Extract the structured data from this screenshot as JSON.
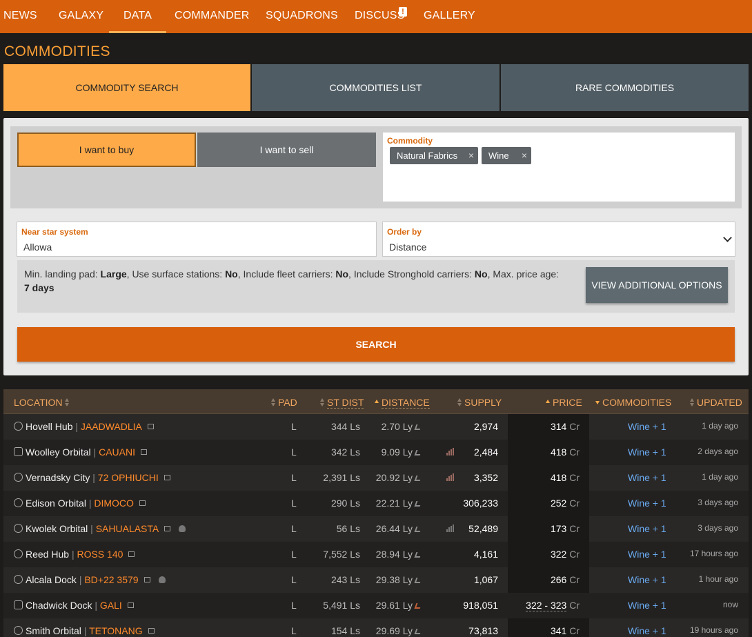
{
  "nav": {
    "items": [
      "NEWS",
      "GALAXY",
      "DATA",
      "COMMANDER",
      "SQUADRONS",
      "DISCUSS",
      "GALLERY"
    ],
    "discuss_badge": "!"
  },
  "page_title": "COMMODITIES",
  "tabs": [
    "COMMODITY SEARCH",
    "COMMODITIES LIST",
    "RARE COMMODITIES"
  ],
  "search": {
    "buy_label": "I want to buy",
    "sell_label": "I want to sell",
    "commodity_label": "Commodity",
    "commodities": [
      "Natural Fabrics",
      "Wine"
    ],
    "remove_glyph": "×",
    "near_label": "Near star system",
    "near_value": "Allowa",
    "order_label": "Order by",
    "order_value": "Distance",
    "options": {
      "pad_label": "Min. landing pad:",
      "pad_value": "Large",
      "surface_label": "Use surface stations:",
      "surface_value": "No",
      "fleet_label": "Include fleet carriers:",
      "fleet_value": "No",
      "stronghold_label": "Include Stronghold carriers:",
      "stronghold_value": "No",
      "age_label": "Max. price age:",
      "age_value": "7 days"
    },
    "view_options_label": "VIEW ADDITIONAL OPTIONS",
    "search_label": "SEARCH"
  },
  "table": {
    "headers": {
      "location": "LOCATION",
      "pad": "PAD",
      "st_dist": "ST DIST",
      "distance": "DISTANCE",
      "supply": "SUPPLY",
      "price": "PRICE",
      "commodities": "COMMODITIES",
      "updated": "UPDATED"
    },
    "rows": [
      {
        "station": "Hovell Hub",
        "system": "JAADWADLIA",
        "pad": "L",
        "st_dist": "344 Ls",
        "distance": "2.70 Ly",
        "supply": "2,974",
        "price": "314",
        "commodities": "Wine + 1",
        "updated": "1 day ago"
      },
      {
        "station": "Woolley Orbital",
        "system": "CAUANI",
        "pad": "L",
        "st_dist": "342 Ls",
        "distance": "9.09 Ly",
        "supply": "2,484",
        "price": "418",
        "commodities": "Wine + 1",
        "updated": "2 days ago"
      },
      {
        "station": "Vernadsky City",
        "system": "72 OPHIUCHI",
        "pad": "L",
        "st_dist": "2,391 Ls",
        "distance": "20.92 Ly",
        "supply": "3,352",
        "price": "418",
        "commodities": "Wine + 1",
        "updated": "1 day ago"
      },
      {
        "station": "Edison Orbital",
        "system": "DIMOCO",
        "pad": "L",
        "st_dist": "290 Ls",
        "distance": "22.21 Ly",
        "supply": "306,233",
        "price": "252",
        "commodities": "Wine + 1",
        "updated": "3 days ago"
      },
      {
        "station": "Kwolek Orbital",
        "system": "SAHUALASTA",
        "pad": "L",
        "st_dist": "56 Ls",
        "distance": "26.44 Ly",
        "supply": "52,489",
        "price": "173",
        "commodities": "Wine + 1",
        "updated": "3 days ago"
      },
      {
        "station": "Reed Hub",
        "system": "ROSS 140",
        "pad": "L",
        "st_dist": "7,552 Ls",
        "distance": "28.94 Ly",
        "supply": "4,161",
        "price": "322",
        "commodities": "Wine + 1",
        "updated": "17 hours ago"
      },
      {
        "station": "Alcala Dock",
        "system": "BD+22 3579",
        "pad": "L",
        "st_dist": "243 Ls",
        "distance": "29.38 Ly",
        "supply": "1,067",
        "price": "266",
        "commodities": "Wine + 1",
        "updated": "1 hour ago"
      },
      {
        "station": "Chadwick Dock",
        "system": "GALI",
        "pad": "L",
        "st_dist": "5,491 Ls",
        "distance": "29.61 Ly",
        "supply": "918,051",
        "price": "322 - 323",
        "commodities": "Wine + 1",
        "updated": "now"
      },
      {
        "station": "Smith Orbital",
        "system": "TETONANG",
        "pad": "L",
        "st_dist": "154 Ls",
        "distance": "29.69 Ly",
        "supply": "73,813",
        "price": "341",
        "commodities": "Wine + 1",
        "updated": "19 hours ago"
      }
    ],
    "price_unit": "Cr",
    "separator": "|"
  },
  "colors": {
    "nav_bg": "#d85f0c",
    "accent": "#ffaa48",
    "system_link": "#ff8a2b",
    "commodity_link": "#6aaaf0"
  }
}
